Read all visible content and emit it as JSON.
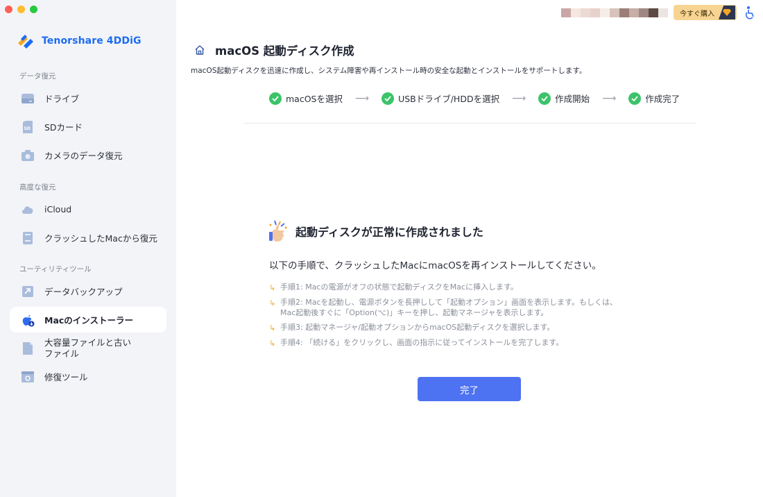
{
  "app": {
    "name": "Tenorshare 4DDiG"
  },
  "sidebar": {
    "sections": [
      {
        "label": "データ復元"
      },
      {
        "label": "高度な復元"
      },
      {
        "label": "ユーティリティツール"
      }
    ],
    "items": [
      {
        "label": "ドライブ",
        "icon": "drive-icon"
      },
      {
        "label": "SDカード",
        "icon": "sd-card-icon"
      },
      {
        "label": "カメラのデータ復元",
        "icon": "camera-icon"
      },
      {
        "label": "iCloud",
        "icon": "cloud-icon"
      },
      {
        "label": "クラッシュしたMacから復元",
        "icon": "crashed-mac-icon"
      },
      {
        "label": "データバックアップ",
        "icon": "backup-icon"
      },
      {
        "label": "Macのインストーラー",
        "icon": "apple-installer-icon",
        "active": true
      },
      {
        "label": "大容量ファイルと古い",
        "label2": "ファイル",
        "icon": "large-files-icon"
      },
      {
        "label": "修復ツール",
        "icon": "repair-tool-icon"
      }
    ]
  },
  "header": {
    "buy_label": "今すぐ購入",
    "title": "macOS 起動ディスク作成",
    "subtitle": "macOS起動ディスクを迅速に作成し、システム障害や再インストール時の安全な起動とインストールをサポートします。"
  },
  "steps": [
    {
      "label": "macOSを選択"
    },
    {
      "label": "USBドライブ/HDDを選択"
    },
    {
      "label": "作成開始"
    },
    {
      "label": "作成完了"
    }
  ],
  "result": {
    "title": "起動ディスクが正常に作成されました",
    "instruction": "以下の手順で、クラッシュしたMacにmacOSを再インストールしてください。",
    "steps": [
      {
        "text": "手順1: Macの電源がオフの状態で起動ディスクをMacに挿入します。"
      },
      {
        "text": "手順2: Macを起動し、電源ボタンを長押しして「起動オプション」画面を表示します。もしくは、",
        "text2": "Mac起動後すぐに「Option(⌥)」キーを押し、起動マネージャを表示します。"
      },
      {
        "text": "手順3: 起動マネージャ/起動オプションからmacOS起動ディスクを選択します。"
      },
      {
        "text": "手順4: 「続ける」をクリックし、画面の指示に従ってインストールを完了します。"
      }
    ],
    "done_label": "完了"
  },
  "colors": {
    "accent": "#4d72f2",
    "brand": "#1b6cf2",
    "success": "#3cc36a",
    "buy": "#f8d493"
  }
}
